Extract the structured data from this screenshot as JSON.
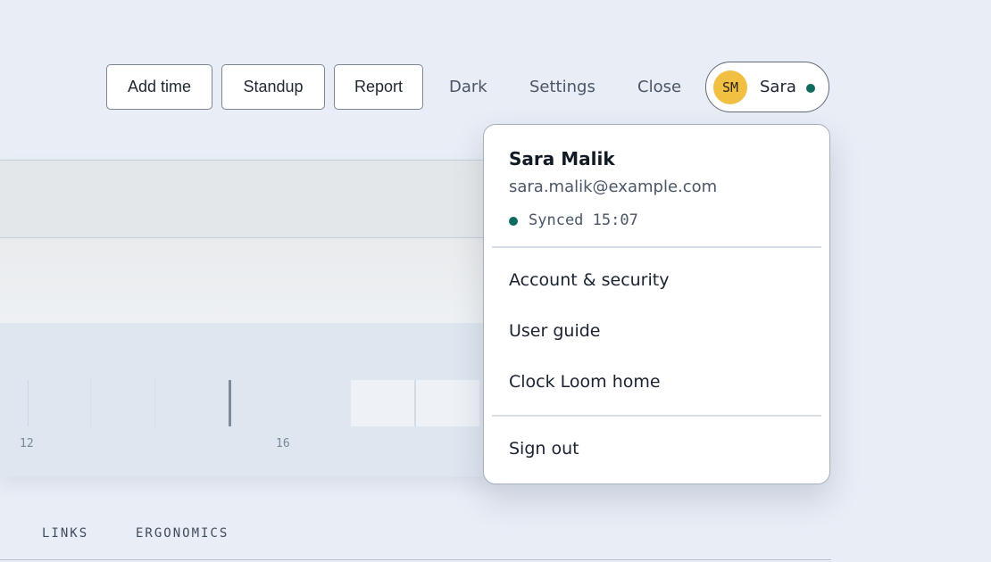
{
  "toolbar": {
    "buttons": [
      "Add time",
      "Standup",
      "Report"
    ],
    "links": [
      "Dark",
      "Settings",
      "Close"
    ]
  },
  "user_chip": {
    "initials": "SM",
    "name": "Sara",
    "status_color": "#0f6b60",
    "avatar_color": "#f1c043"
  },
  "menu": {
    "full_name": "Sara Malik",
    "email": "sara.malik@example.com",
    "sync_status": "Synced 15:07",
    "items": [
      "Account & security",
      "User guide",
      "Clock Loom home"
    ],
    "sign_out": "Sign out"
  },
  "timeline": {
    "tick_labels": [
      "12",
      "16"
    ]
  },
  "bottom_tabs": [
    "LINKS",
    "ERGONOMICS"
  ],
  "colors": {
    "background": "#e8edf6",
    "accent_teal": "#0f6b60"
  }
}
